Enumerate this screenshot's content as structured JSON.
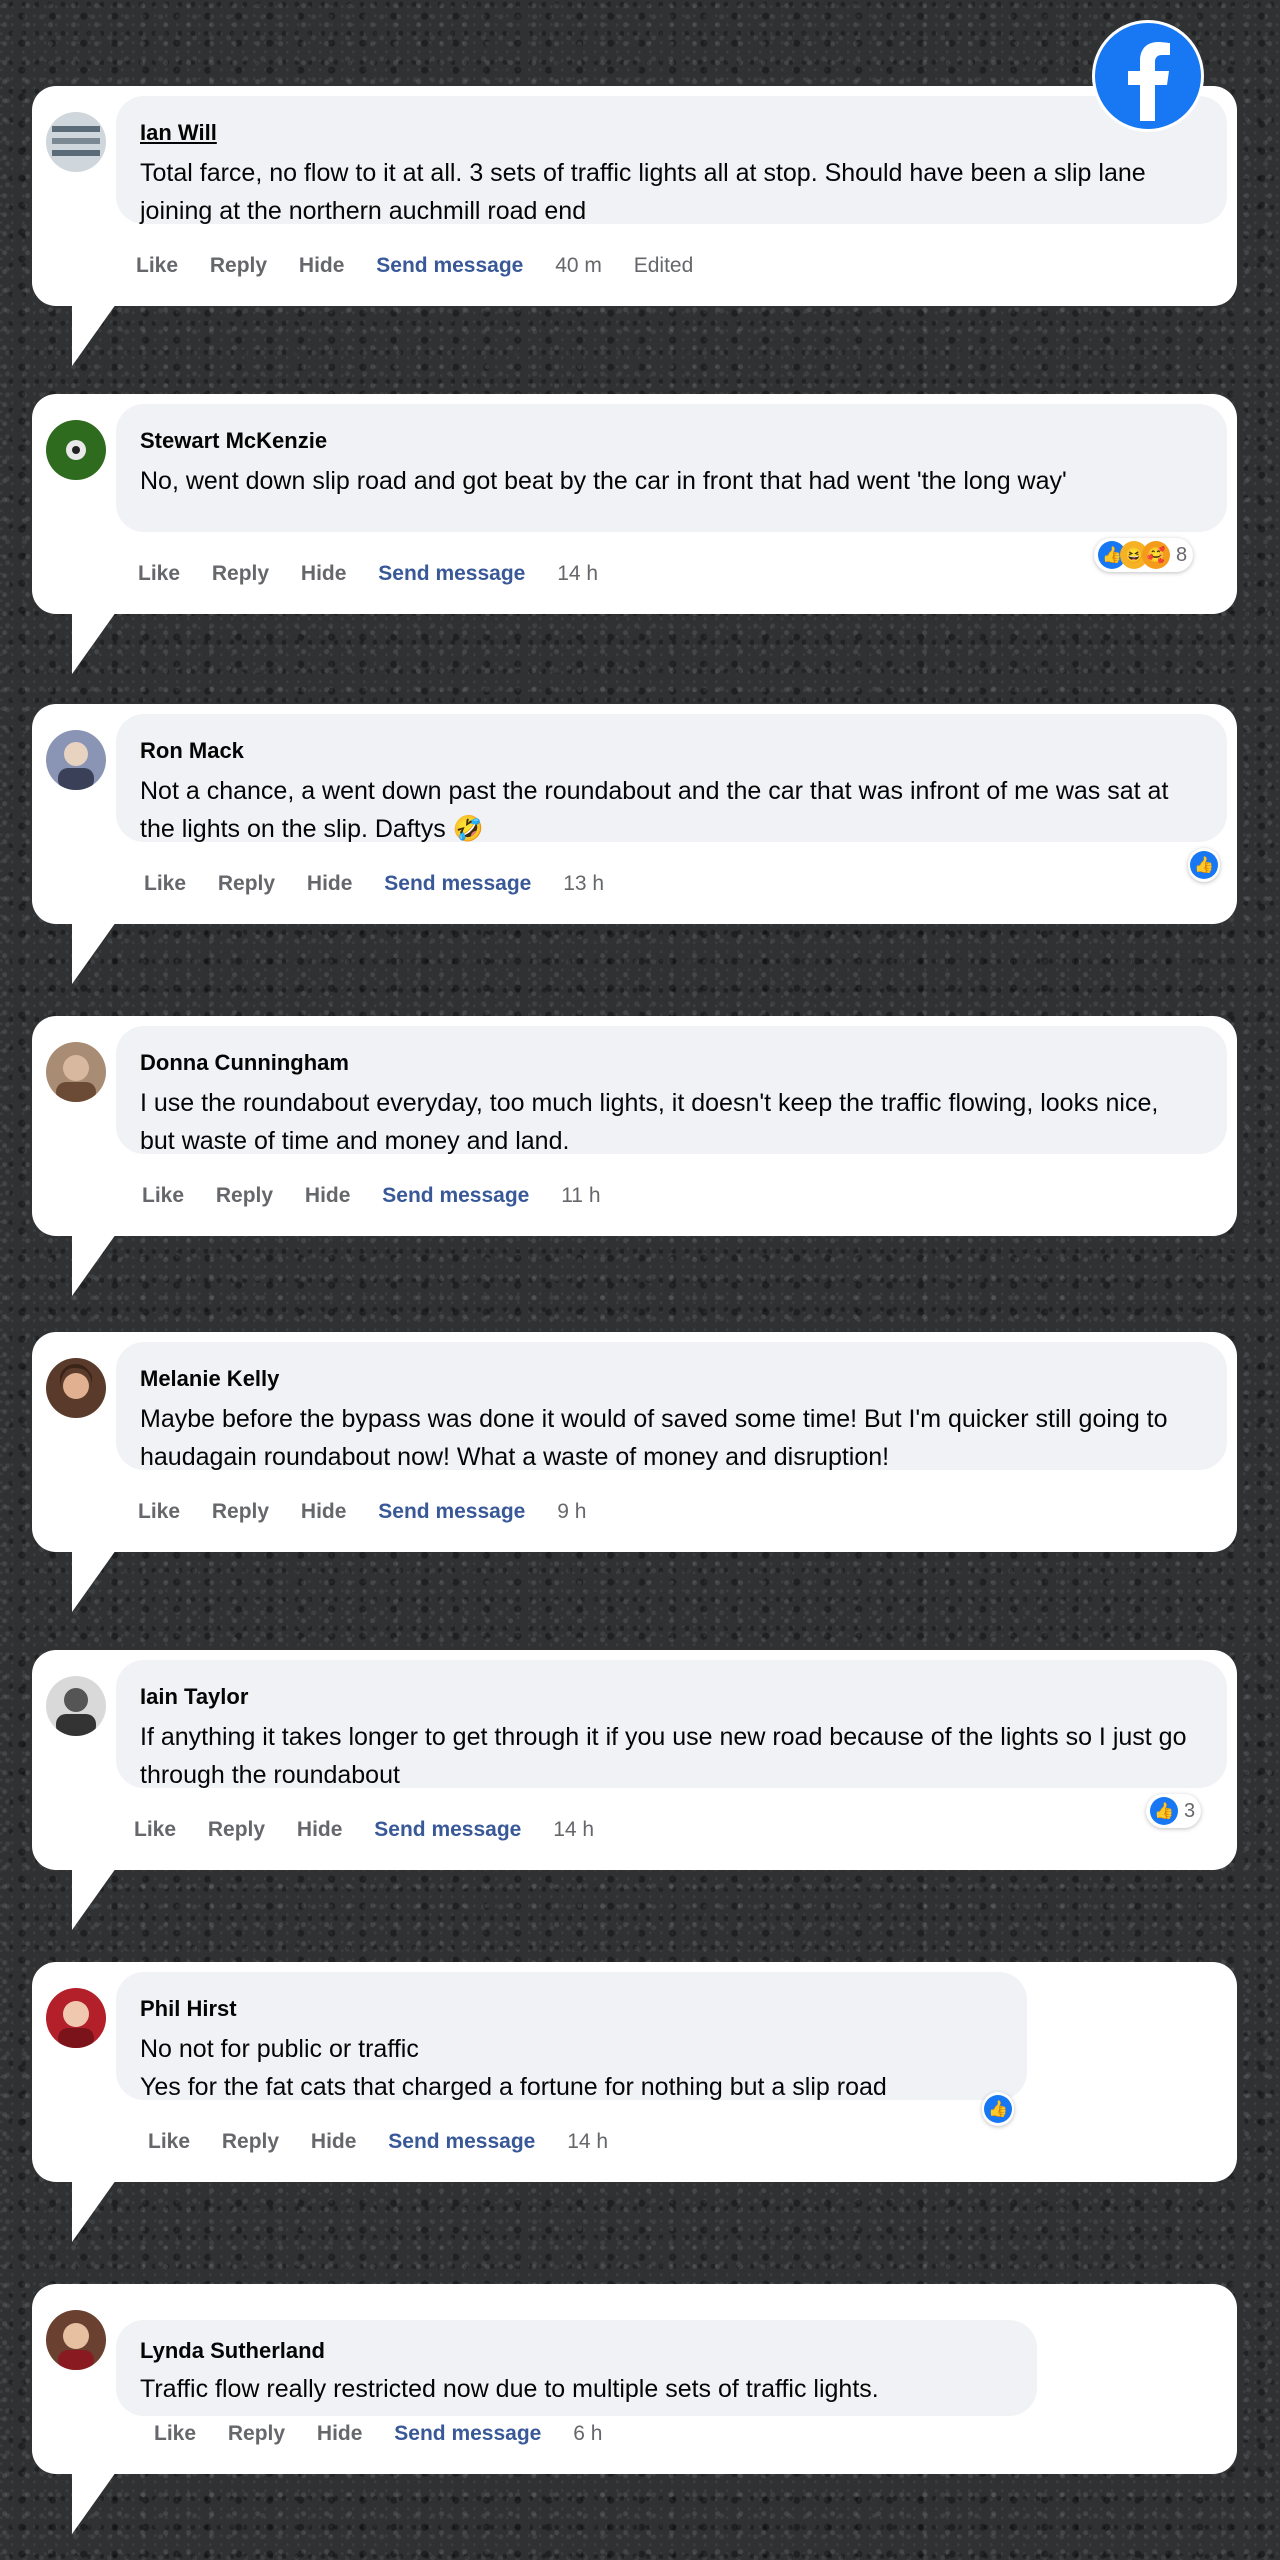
{
  "brand": {
    "icon": "facebook-logo-icon",
    "color": "#1877f2"
  },
  "actions": {
    "like": "Like",
    "reply": "Reply",
    "hide": "Hide",
    "send": "Send message"
  },
  "comments": [
    {
      "name": "Ian Will",
      "text": "Total farce, no flow to it at all. 3 sets of traffic lights all at stop. Should have been a slip lane joining at the northern auchmill road end",
      "time": "40 m",
      "edited": "Edited",
      "reactions": ""
    },
    {
      "name": "Stewart McKenzie",
      "text": "No, went down slip road and got beat by the car in front that had went 'the long way'",
      "time": "14 h",
      "reactions": "8"
    },
    {
      "name": "Ron Mack",
      "text": "Not a chance, a went down past the roundabout and the car that was infront of me was sat at the lights on the slip. Daftys 🤣",
      "time": "13 h",
      "reactions": ""
    },
    {
      "name": "Donna Cunningham",
      "text": "I use the roundabout everyday, too much lights, it doesn't keep the traffic flowing, looks nice, but waste of time and money and land.",
      "time": "11 h",
      "reactions": ""
    },
    {
      "name": "Melanie Kelly",
      "text": "Maybe before the bypass was done it would of saved some time! But I'm quicker still going to haudagain roundabout now! What a waste of money and disruption!",
      "time": "9 h",
      "reactions": ""
    },
    {
      "name": "Iain Taylor",
      "text": "If anything it takes longer to get through it if you use new road because of the lights so I just go through the roundabout",
      "time": "14 h",
      "reactions": "3"
    },
    {
      "name": "Phil Hirst",
      "text": "No not for public or traffic\nYes for the fat cats that charged a fortune for nothing but a slip road",
      "time": "14 h",
      "reactions": ""
    },
    {
      "name": "Lynda Sutherland",
      "text": "Traffic flow really restricted now due to multiple sets of traffic lights.",
      "time": "6 h",
      "reactions": ""
    }
  ]
}
